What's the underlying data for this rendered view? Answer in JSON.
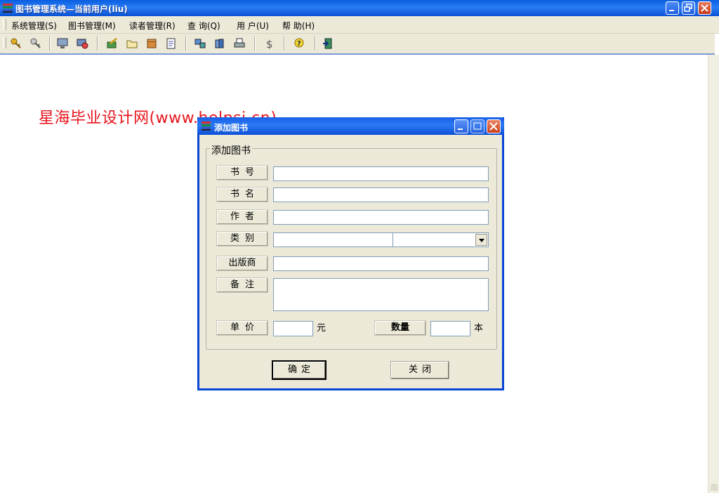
{
  "window": {
    "title": "图书管理系统—当前用户(liu)"
  },
  "menubar": {
    "items": [
      "系统管理(S)",
      "图书管理(M)",
      "读者管理(R)",
      "查 询(Q)",
      "用 户(U)",
      "帮 助(H)"
    ]
  },
  "toolbar": {
    "icons": [
      "key-icon",
      "key-alt-icon",
      "monitor-icon",
      "users-icon",
      "edit-book-icon",
      "folder-icon",
      "box-icon",
      "notepad-icon",
      "network-icon",
      "books-icon",
      "printer-icon",
      "dollar-icon",
      "help-icon",
      "exit-door-icon"
    ]
  },
  "watermark": "星海毕业设计网(www.helpsj.cn)",
  "dialog": {
    "title": "添加图书",
    "group_caption": "添加图书",
    "labels": {
      "book_no": "书号",
      "book_name": "书名",
      "author": "作者",
      "category": "类别",
      "publisher": "出版商",
      "remarks": "备注",
      "price": "单价",
      "quantity": "数量"
    },
    "values": {
      "book_no": "",
      "book_name": "",
      "author": "",
      "category_text": "",
      "category_select": "",
      "publisher": "",
      "remarks": "",
      "price": "",
      "quantity": ""
    },
    "units": {
      "price": "元",
      "quantity": "本"
    },
    "buttons": {
      "ok": "确定",
      "close": "关闭"
    }
  },
  "colors": {
    "titlebar": "#0a5fe0",
    "watermark": "#e8131b",
    "dialog_bg": "#ece9d8"
  }
}
